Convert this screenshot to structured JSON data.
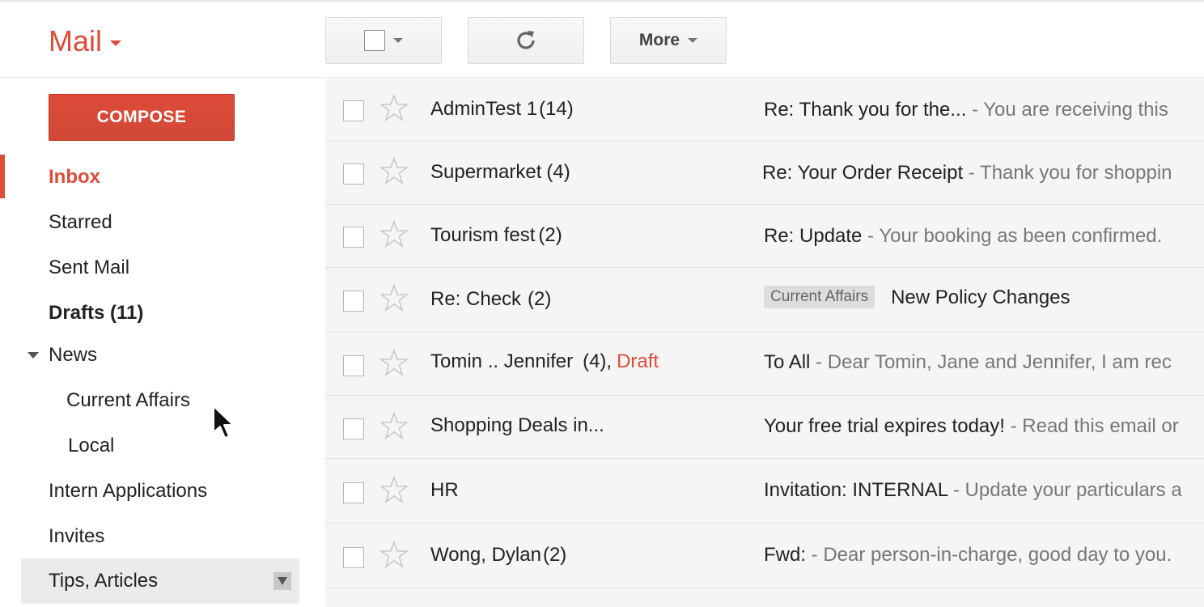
{
  "header": {
    "app_title": "Mail",
    "more_label": "More"
  },
  "sidebar": {
    "compose_label": "COMPOSE",
    "items": [
      {
        "label": "Inbox"
      },
      {
        "label": "Starred"
      },
      {
        "label": "Sent Mail"
      },
      {
        "label": "Drafts (11)"
      },
      {
        "label": "News"
      },
      {
        "label": "Current Affairs"
      },
      {
        "label": "Local"
      },
      {
        "label": "Intern Applications"
      },
      {
        "label": "Invites"
      },
      {
        "label": "Tips, Articles"
      }
    ]
  },
  "emails": [
    {
      "sender": "AdminTest 1",
      "count": "(14)",
      "subject": "Re: Thank you for the...",
      "snippet": " - You are receiving this"
    },
    {
      "sender": "Supermarket",
      "count": "(4)",
      "subject": "Re: Your Order Receipt",
      "snippet": " - Thank you for shoppin"
    },
    {
      "sender": "Tourism fest",
      "count": "(2)",
      "subject": "Re: Update",
      "snippet": " - Your booking as been confirmed."
    },
    {
      "sender": "Re: Check",
      "count": "(2)",
      "label": "Current Affairs",
      "subject": "New Policy Changes",
      "snippet": ""
    },
    {
      "sender": "Tomin .. Jennifer",
      "count": "(4),",
      "draft": "Draft",
      "subject": "To All",
      "snippet": " - Dear Tomin, Jane and Jennifer, I am rec"
    },
    {
      "sender": "Shopping Deals in...",
      "count": "",
      "subject": "Your free trial expires today!",
      "snippet": " - Read this email or"
    },
    {
      "sender": "HR",
      "count": "",
      "subject": "Invitation: INTERNAL",
      "snippet": " - Update your particulars a"
    },
    {
      "sender": "Wong, Dylan",
      "count": "(2)",
      "subject": "Fwd:",
      "snippet": " - Dear person-in-charge, good day to you."
    }
  ]
}
